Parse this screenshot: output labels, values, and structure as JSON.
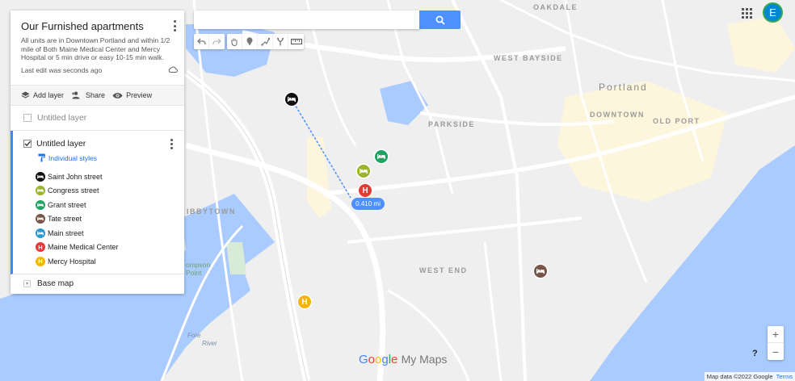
{
  "map": {
    "title": "Our Furnished apartments",
    "description": "All units are in Downtown Portland and within 1/2 mile of Both Maine Medical Center and Mercy Hospital or 5 min drive or easy 10-15 min walk.",
    "last_edit": "Last edit was seconds ago"
  },
  "actions": {
    "add_layer": "Add layer",
    "share": "Share",
    "preview": "Preview"
  },
  "layers": [
    {
      "name": "Untitled layer",
      "checked": false
    },
    {
      "name": "Untitled layer",
      "checked": true,
      "style": "Individual styles",
      "items": [
        {
          "label": "Saint John street",
          "color": "#111111",
          "icon": "bed-icon"
        },
        {
          "label": "Congress street",
          "color": "#9bb52a",
          "icon": "bed-icon"
        },
        {
          "label": "Grant street",
          "color": "#1ea362",
          "icon": "bed-icon"
        },
        {
          "label": "Tate street",
          "color": "#795548",
          "icon": "bed-icon"
        },
        {
          "label": "Main street",
          "color": "#2a98d4",
          "icon": "bed-icon"
        },
        {
          "label": "Maine Medical Center",
          "color": "#e53935",
          "icon": "hospital-icon",
          "glyph": "H"
        },
        {
          "label": "Mercy Hospital",
          "color": "#f4b400",
          "icon": "hospital-icon",
          "glyph": "H"
        }
      ]
    }
  ],
  "base_map": "Base map",
  "search": {
    "placeholder": "",
    "value": ""
  },
  "user_initial": "E",
  "distance_label": "0.410 mi",
  "map_labels": {
    "oakdale": "OAKDALE",
    "west_bayside": "WEST BAYSIDE",
    "portland": "Portland",
    "parkside": "PARKSIDE",
    "downtown": "DOWNTOWN",
    "old_port": "OLD PORT",
    "libbytown": "IBBYTOWN",
    "west_end": "WEST END",
    "thompson_point_1": "ompson",
    "thompson_point_2": "Point",
    "fore_river_1": "Fore",
    "fore_river_2": "River"
  },
  "logo": {
    "g1": "G",
    "g2": "o",
    "g3": "o",
    "g4": "g",
    "g5": "l",
    "g6": "e",
    "suffix": "My Maps"
  },
  "footer": {
    "attribution": "Map data ©2022 Google",
    "terms": "Terms"
  },
  "zoom": {
    "in": "+",
    "out": "−"
  },
  "help": "?",
  "colors": {
    "accent": "#4285f4",
    "search_button": "#4d90fe",
    "water": "#aacbff",
    "land": "#eeeeee"
  }
}
